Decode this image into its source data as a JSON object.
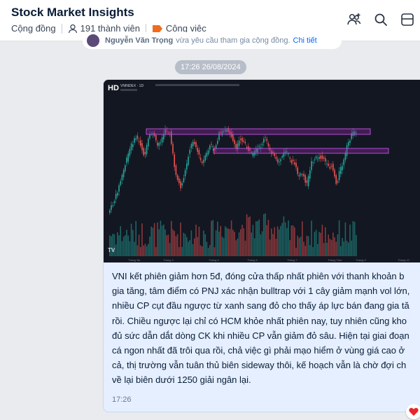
{
  "header": {
    "title": "Stock Market Insights",
    "community_label": "Cộng đồng",
    "members_label": "191 thành viên",
    "tag_label": "Công việc",
    "tag_color": "#f26b1d",
    "icons": [
      "add-members-icon",
      "search-icon",
      "more-icon"
    ]
  },
  "notice": {
    "user": "Nguyễn Văn Trọng",
    "text": "vừa yêu cầu tham gia cộng đồng.",
    "link": "Chi tiết"
  },
  "timestamp_pill": "17:26 26/08/2024",
  "message": {
    "chart_image": {
      "badge": "HD",
      "symbol": "VNINDEX · 1D",
      "x_labels": [
        "Tháng Ba",
        "Tháng 4",
        "Tháng 5",
        "Tháng 6",
        "Tháng 7",
        "Tháng Tám",
        "Tháng 9",
        "Tháng 10"
      ],
      "up_color": "#26a69a",
      "down_color": "#ef5350",
      "zone_color": "#9c27b0"
    },
    "text": "VNI kết phiên giảm hơn 5đ, đóng cửa thấp nhất phiên với thanh khoản b\ngia tăng, tâm điểm có PNJ xác nhận bulltrap với 1 cây giảm mạnh vol lớn,\nnhiều CP cụt đầu ngược từ xanh sang đỏ cho thấy áp lực bán đang gia tă\nrồi. Chiều ngược lại chỉ có HCM khỏe nhất phiên nay, tuy nhiên cũng kho\nđủ sức dẫn dắt dòng CK khi nhiều CP vẫn giảm đỏ sâu. Hiện tại giai đoạn\ncá ngon nhất đã trôi qua rồi, chả việc gì phải mạo hiểm ở vùng giá cao ở\ncả, thị trường vẫn tuân thủ biên sideway thôi, kế hoạch vẫn là chờ đợi ch\nvề lại biên dưới 1250 giải ngân lại.",
    "time": "17:26",
    "reaction_icon": "heart-icon"
  }
}
